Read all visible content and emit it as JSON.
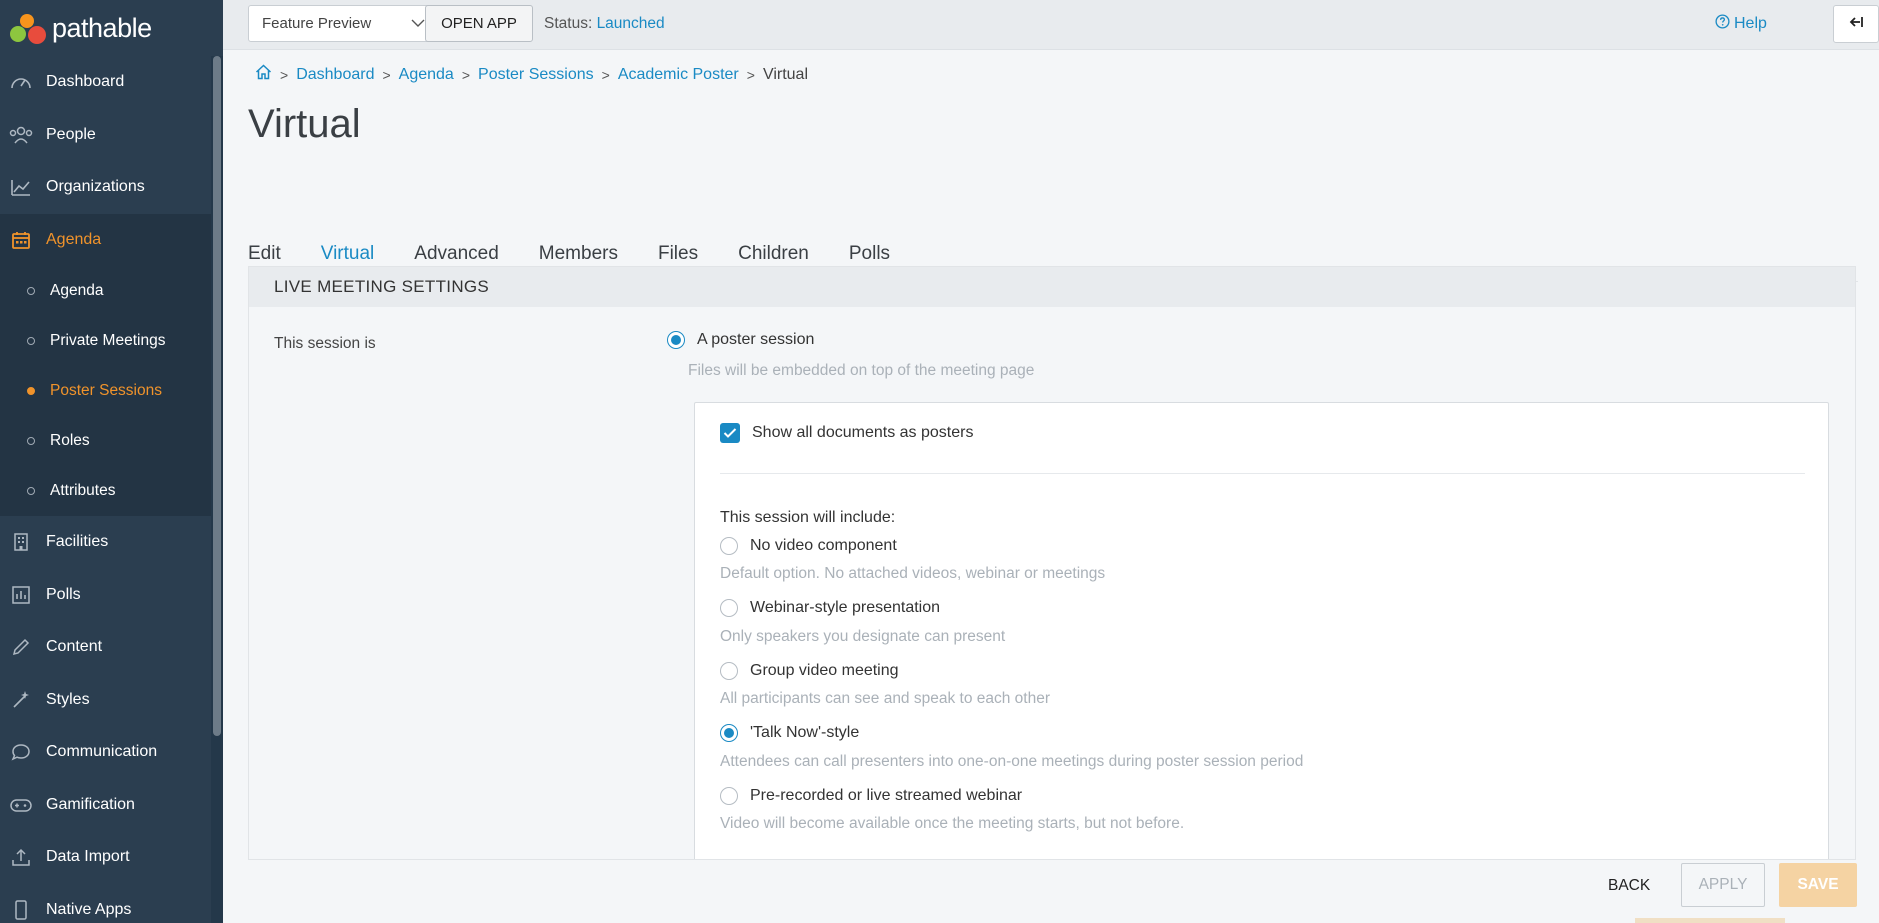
{
  "app": {
    "logo_text": "pathable"
  },
  "sidebar": {
    "items": [
      {
        "label": "Dashboard",
        "icon": "dashboard-icon"
      },
      {
        "label": "People",
        "icon": "people-icon"
      },
      {
        "label": "Organizations",
        "icon": "organizations-icon"
      },
      {
        "label": "Agenda",
        "icon": "calendar-icon",
        "active": true
      },
      {
        "label": "Facilities",
        "icon": "building-icon"
      },
      {
        "label": "Polls",
        "icon": "polls-icon"
      },
      {
        "label": "Content",
        "icon": "pencil-icon"
      },
      {
        "label": "Styles",
        "icon": "magic-wand-icon"
      },
      {
        "label": "Communication",
        "icon": "chat-bubble-icon"
      },
      {
        "label": "Gamification",
        "icon": "gamepad-icon"
      },
      {
        "label": "Data Import",
        "icon": "upload-icon"
      },
      {
        "label": "Native Apps",
        "icon": "phone-icon"
      }
    ],
    "agenda_sub": [
      {
        "label": "Agenda"
      },
      {
        "label": "Private Meetings"
      },
      {
        "label": "Poster Sessions",
        "active": true
      },
      {
        "label": "Roles"
      },
      {
        "label": "Attributes"
      }
    ]
  },
  "topbar": {
    "feature_select": "Feature Preview",
    "open_app": "OPEN APP",
    "status_label": "Status:",
    "status_value": "Launched",
    "help": "Help"
  },
  "breadcrumb": [
    "Dashboard",
    "Agenda",
    "Poster Sessions",
    "Academic Poster",
    "Virtual"
  ],
  "page_title": "Virtual",
  "tabs": [
    "Edit",
    "Virtual",
    "Advanced",
    "Members",
    "Files",
    "Children",
    "Polls"
  ],
  "active_tab": "Virtual",
  "panel": {
    "header": "LIVE MEETING SETTINGS",
    "session_label": "This session is",
    "poster_option": "A poster session",
    "poster_desc": "Files will be embedded on top of the meeting page",
    "show_docs": "Show all documents as posters",
    "include_label": "This session will include:",
    "options": [
      {
        "label": "No video component",
        "desc": "Default option. No attached videos, webinar or meetings",
        "checked": false
      },
      {
        "label": "Webinar-style presentation",
        "desc": "Only speakers you designate can present",
        "checked": false
      },
      {
        "label": "Group video meeting",
        "desc": "All participants can see and speak to each other",
        "checked": false
      },
      {
        "label": "'Talk Now'-style",
        "desc": "Attendees can call presenters into one-on-one meetings during poster session period",
        "checked": true
      },
      {
        "label": "Pre-recorded or live streamed webinar",
        "desc": "Video will become available once the meeting starts, but not before.",
        "checked": false
      }
    ]
  },
  "footer": {
    "back": "BACK",
    "apply": "APPLY",
    "save": "SAVE"
  },
  "colors": {
    "accent": "#1a8ac4",
    "active_orange": "#f0932b",
    "sidebar_bg": "#2b3e50"
  }
}
